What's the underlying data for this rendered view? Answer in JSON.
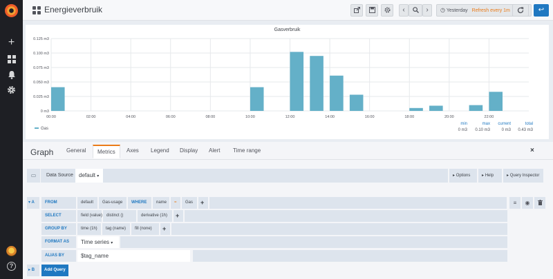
{
  "navbar": {
    "title": "Energieverbruik",
    "time_range": "Yesterday",
    "refresh": "Refresh every 1m"
  },
  "panel": {
    "title": "Gasverbruik"
  },
  "chart_data": {
    "type": "bar",
    "title": "Gasverbruik",
    "xlabel": "",
    "ylabel": "",
    "ylim": [
      0,
      0.125
    ],
    "yticks": [
      "0 m3",
      "0.025 m3",
      "0.050 m3",
      "0.075 m3",
      "0.100 m3",
      "0.125 m3"
    ],
    "xticks": [
      "00:00",
      "02:00",
      "04:00",
      "06:00",
      "08:00",
      "10:00",
      "12:00",
      "14:00",
      "16:00",
      "18:00",
      "20:00",
      "22:00"
    ],
    "series": [
      {
        "name": "Gas",
        "color": "#64b0c8",
        "points": [
          {
            "hour": 0,
            "value": 0.041
          },
          {
            "hour": 10,
            "value": 0.041
          },
          {
            "hour": 12,
            "value": 0.102
          },
          {
            "hour": 13,
            "value": 0.095
          },
          {
            "hour": 14,
            "value": 0.061
          },
          {
            "hour": 15,
            "value": 0.028
          },
          {
            "hour": 18,
            "value": 0.005
          },
          {
            "hour": 19,
            "value": 0.009
          },
          {
            "hour": 21,
            "value": 0.01
          },
          {
            "hour": 22,
            "value": 0.033
          }
        ]
      }
    ],
    "grid": true,
    "legend": {
      "placement": "bottom",
      "entry": "Gas",
      "headers": [
        "min",
        "max",
        "current",
        "total"
      ],
      "values": [
        "0 m3",
        "0.10 m3",
        "0 m3",
        "0.43 m3"
      ]
    }
  },
  "editor": {
    "title": "Graph",
    "tabs": [
      "General",
      "Metrics",
      "Axes",
      "Legend",
      "Display",
      "Alert",
      "Time range"
    ],
    "active_tab": "Metrics",
    "close": "×",
    "datasource": {
      "label": "Data Source",
      "value": "default",
      "options_btn": "Options",
      "help_btn": "Help",
      "inspector_btn": "Query Inspector"
    },
    "query": {
      "ref": "A",
      "from_label": "FROM",
      "from_policy": "default",
      "from_measurement": "Gas-usage",
      "where_label": "WHERE",
      "where_key": "name",
      "where_op": "=",
      "where_value": "Gas",
      "select_label": "SELECT",
      "select_parts": [
        "field (value)",
        "distinct ()",
        "derivative (1h)"
      ],
      "groupby_label": "GROUP BY",
      "groupby_parts": [
        "time (1h)",
        "tag (name)",
        "fill (none)"
      ],
      "format_label": "FORMAT AS",
      "format_value": "Time series",
      "alias_label": "ALIAS BY",
      "alias_value": "$tag_name"
    },
    "query_b": "B",
    "add_query": "Add Query"
  }
}
